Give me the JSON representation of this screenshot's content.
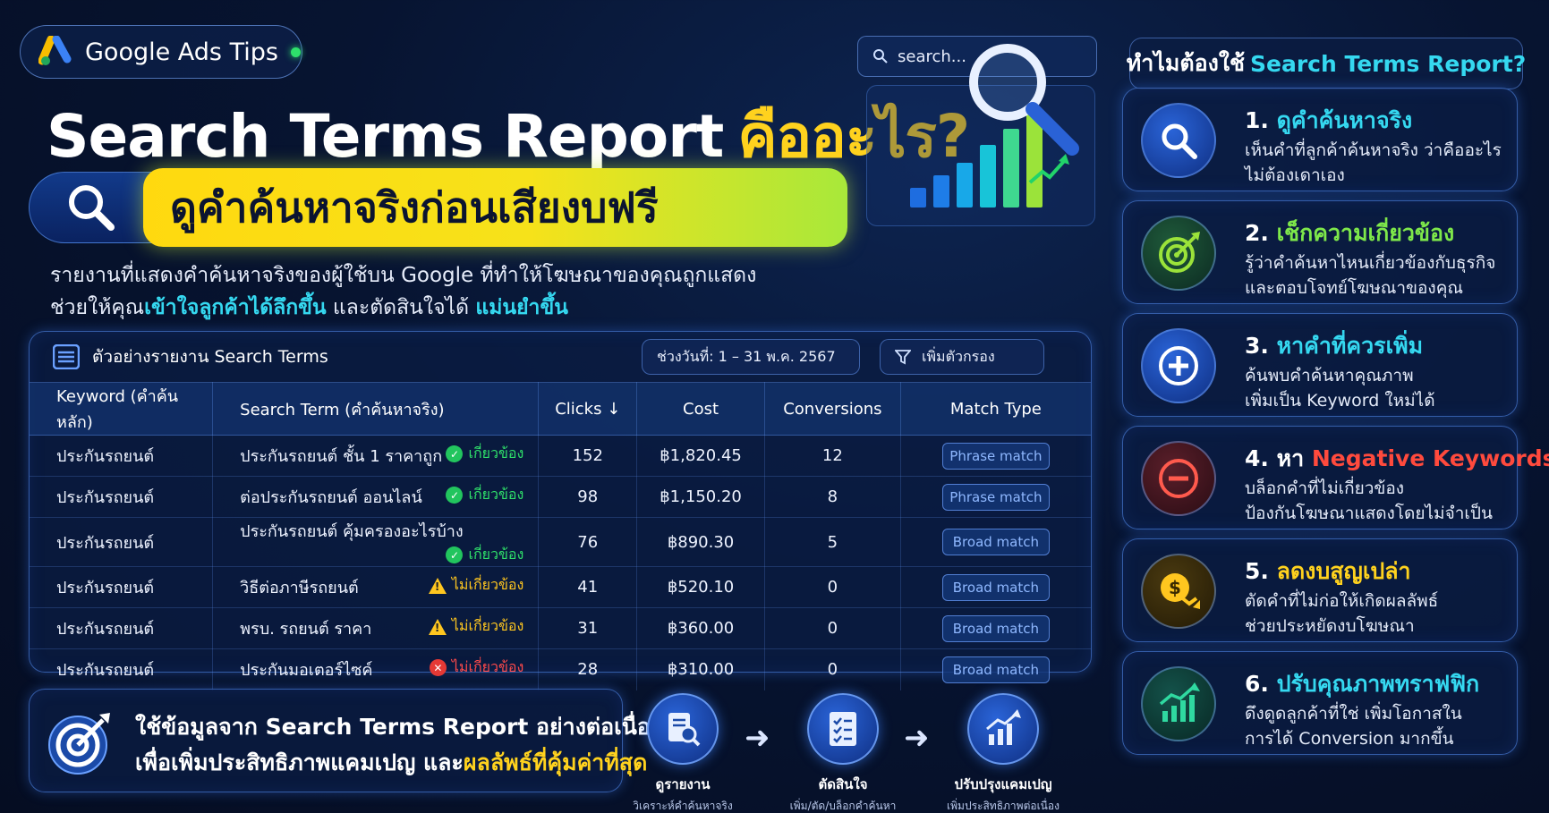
{
  "brand": {
    "label": "Google Ads Tips"
  },
  "title": {
    "part1": "Search Terms Report",
    "part2": "คืออะไร?"
  },
  "subtitle": "ดูคำค้นหาจริงก่อนเสียงบฟรี",
  "description": {
    "line1": "รายงานที่แสดงคำค้นหาจริงของผู้ใช้บน Google ที่ทำให้โฆษณาของคุณถูกแสดง",
    "line2_a": "ช่วยให้คุณ",
    "line2_hl1": "เข้าใจลูกค้าได้ลึกขึ้น",
    "line2_b": " และตัดสินใจได้ ",
    "line2_hl2": "แม่นยำขึ้น"
  },
  "search_widget": {
    "placeholder": "search..."
  },
  "report": {
    "title": "ตัวอย่างรายงาน Search Terms",
    "date_range": "ช่วงวันที่: 1 – 31 พ.ค. 2567",
    "filter_label": "เพิ่มตัวกรอง",
    "columns": [
      "Keyword (คำค้นหลัก)",
      "Search Term (คำค้นหาจริง)",
      "Clicks ↓",
      "Cost",
      "Conversions",
      "Match Type"
    ],
    "rows": [
      {
        "keyword": "ประกันรถยนต์",
        "term": "ประกันรถยนต์ ชั้น 1 ราคาถูก",
        "status": "เกี่ยวข้อง",
        "status_type": "ok",
        "clicks": "152",
        "cost": "฿1,820.45",
        "conversions": "12",
        "match": "Phrase match"
      },
      {
        "keyword": "ประกันรถยนต์",
        "term": "ต่อประกันรถยนต์ ออนไลน์",
        "status": "เกี่ยวข้อง",
        "status_type": "ok",
        "clicks": "98",
        "cost": "฿1,150.20",
        "conversions": "8",
        "match": "Phrase match"
      },
      {
        "keyword": "ประกันรถยนต์",
        "term": "ประกันรถยนต์ คุ้มครองอะไรบ้าง",
        "status": "เกี่ยวข้อง",
        "status_type": "ok",
        "clicks": "76",
        "cost": "฿890.30",
        "conversions": "5",
        "match": "Broad match"
      },
      {
        "keyword": "ประกันรถยนต์",
        "term": "วิธีต่อภาษีรถยนต์",
        "status": "ไม่เกี่ยวข้อง",
        "status_type": "warn",
        "clicks": "41",
        "cost": "฿520.10",
        "conversions": "0",
        "match": "Broad match"
      },
      {
        "keyword": "ประกันรถยนต์",
        "term": "พรบ. รถยนต์ ราคา",
        "status": "ไม่เกี่ยวข้อง",
        "status_type": "warn",
        "clicks": "31",
        "cost": "฿360.00",
        "conversions": "0",
        "match": "Broad match"
      },
      {
        "keyword": "ประกันรถยนต์",
        "term": "ประกันมอเตอร์ไซค์",
        "status": "ไม่เกี่ยวข้อง",
        "status_type": "bad",
        "clicks": "28",
        "cost": "฿310.00",
        "conversions": "0",
        "match": "Broad match"
      }
    ]
  },
  "banner": {
    "line1": "ใช้ข้อมูลจาก Search Terms Report อย่างต่อเนื่อง",
    "line2_a": "เพื่อเพิ่มประสิทธิภาพแคมเปญ และ",
    "line2_hl": "ผลลัพธ์ที่คุ้มค่าที่สุด"
  },
  "flow": [
    {
      "label": "ดูรายงาน",
      "sub": "วิเคราะห์คำค้นหาจริง",
      "icon": "report-search-icon"
    },
    {
      "label": "ตัดสินใจ",
      "sub": "เพิ่ม/ตัด/บล็อกคำค้นหา",
      "icon": "checklist-icon"
    },
    {
      "label": "ปรับปรุงแคมเปญ",
      "sub": "เพิ่มประสิทธิภาพต่อเนื่อง",
      "icon": "growth-chart-icon"
    }
  ],
  "why": {
    "title_a": "ทำไมต้องใช้",
    "title_b": "Search Terms Report?",
    "items": [
      {
        "num": "1.",
        "head": "ดูคำค้นหาจริง",
        "head_pre": "",
        "color": "#35d8f0",
        "d1": "เห็นคำที่ลูกค้าค้นหาจริง ว่าคืออะไร",
        "d2": "ไม่ต้องเดาเอง",
        "icon": "magnifier-icon"
      },
      {
        "num": "2.",
        "head": "เช็กความเกี่ยวข้อง",
        "head_pre": "",
        "color": "#7ee84a",
        "d1": "รู้ว่าคำค้นหาไหนเกี่ยวข้องกับธุรกิจ",
        "d2": "และตอบโจทย์โฆษณาของคุณ",
        "icon": "target-icon"
      },
      {
        "num": "3.",
        "head": "หาคำที่ควรเพิ่ม",
        "head_pre": "",
        "color": "#35d8f0",
        "d1": "ค้นพบคำค้นหาคุณภาพ",
        "d2": "เพิ่มเป็น Keyword ใหม่ได้",
        "icon": "plus-circle-icon"
      },
      {
        "num": "4.",
        "head": "Negative Keywords",
        "head_pre": "หา ",
        "color": "#ff4a3d",
        "d1": "บล็อกคำที่ไม่เกี่ยวข้อง",
        "d2": "ป้องกันโฆษณาแสดงโดยไม่จำเป็น",
        "icon": "minus-circle-icon"
      },
      {
        "num": "5.",
        "head": "ลดงบสูญเปล่า",
        "head_pre": "",
        "color": "#ffd21e",
        "d1": "ตัดคำที่ไม่ก่อให้เกิดผลลัพธ์",
        "d2": "ช่วยประหยัดงบโฆษณา",
        "icon": "money-down-icon"
      },
      {
        "num": "6.",
        "head": "ปรับคุณภาพทราฟฟิก",
        "head_pre": "",
        "color": "#35d8f0",
        "d1": "ดึงดูดลูกค้าที่ใช่ เพิ่มโอกาสใน",
        "d2": "การได้ Conversion มากขึ้น",
        "icon": "trend-up-icon"
      }
    ]
  },
  "colors": {
    "accent_yellow": "#ffd21e",
    "accent_cyan": "#35d8f0",
    "ok_green": "#2fe06a",
    "warn_yellow": "#ffc61f",
    "bad_red": "#ff4a4a",
    "bg": "#071431"
  }
}
